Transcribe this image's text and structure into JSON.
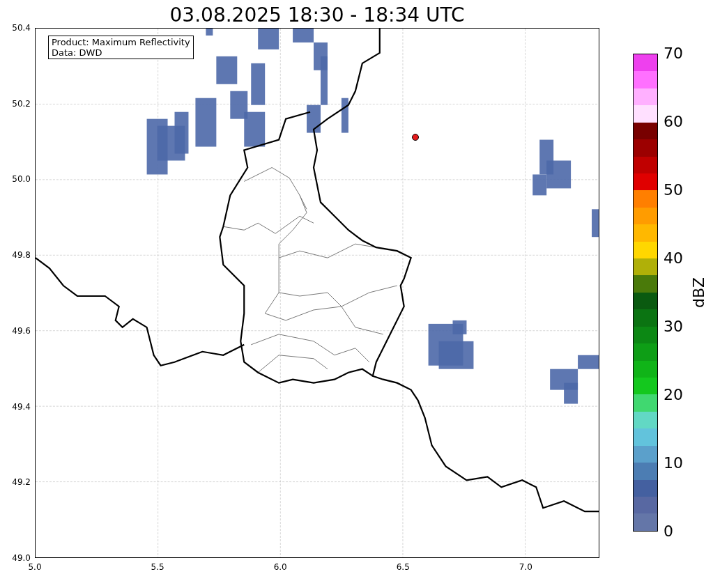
{
  "title": "03.08.2025 18:30 - 18:34 UTC",
  "annotation": [
    "Product: Maximum Reflectivity",
    "Data: DWD"
  ],
  "x_ticks": [
    "5.0",
    "5.5",
    "6.0",
    "6.5",
    "7.0"
  ],
  "y_ticks": [
    "50.4",
    "50.2",
    "50.0",
    "49.8",
    "49.6",
    "49.4",
    "49.2",
    "49.0"
  ],
  "colorbar": {
    "label": "dBZ",
    "ticks": [
      "70",
      "60",
      "50",
      "40",
      "30",
      "20",
      "10",
      "0"
    ],
    "segments": [
      {
        "color": "#ee40ee"
      },
      {
        "color": "#ff70ff"
      },
      {
        "color": "#ffb0ff"
      },
      {
        "color": "#ffe0ff"
      },
      {
        "color": "#780000"
      },
      {
        "color": "#9c0000"
      },
      {
        "color": "#c00000"
      },
      {
        "color": "#e00000"
      },
      {
        "color": "#ff7f00"
      },
      {
        "color": "#ff9c00"
      },
      {
        "color": "#ffb800"
      },
      {
        "color": "#ffd700"
      },
      {
        "color": "#b0b008"
      },
      {
        "color": "#4a7a0a"
      },
      {
        "color": "#0a5a10"
      },
      {
        "color": "#0b7412"
      },
      {
        "color": "#0c8814"
      },
      {
        "color": "#0e9e16"
      },
      {
        "color": "#10b418"
      },
      {
        "color": "#14c81e"
      },
      {
        "color": "#40d870"
      },
      {
        "color": "#62d8c4"
      },
      {
        "color": "#62c3dc"
      },
      {
        "color": "#5ba0cb"
      },
      {
        "color": "#4c7db3"
      },
      {
        "color": "#4460a0"
      },
      {
        "color": "#5868a2"
      },
      {
        "color": "#6476a8"
      }
    ]
  }
}
